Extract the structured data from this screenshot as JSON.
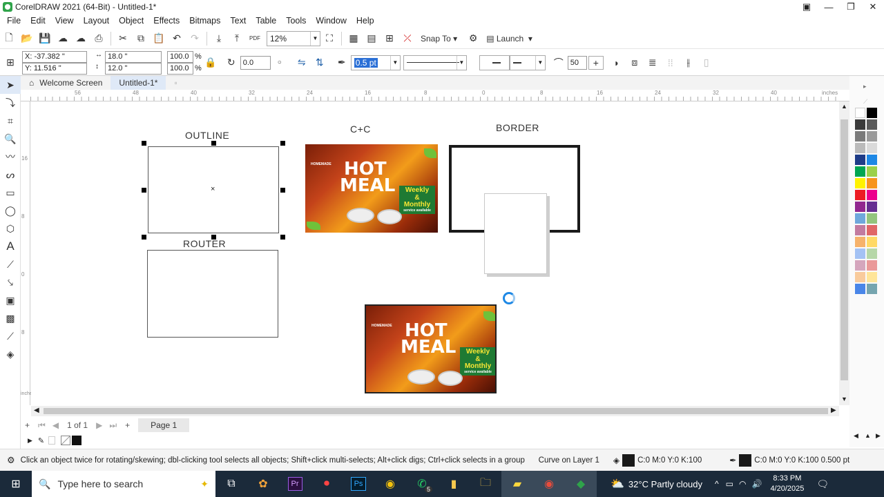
{
  "window": {
    "title": "CorelDRAW 2021 (64-Bit) - Untitled-1*"
  },
  "menu": [
    "File",
    "Edit",
    "View",
    "Layout",
    "Object",
    "Effects",
    "Bitmaps",
    "Text",
    "Table",
    "Tools",
    "Window",
    "Help"
  ],
  "toolbar": {
    "zoom": "12%",
    "snap_label": "Snap To",
    "launch_label": "Launch",
    "pdf_label": "PDF"
  },
  "props": {
    "x": "X: -37.382 \"",
    "y": "Y: 11.516 \"",
    "w": "18.0 \"",
    "h": "12.0 \"",
    "sx": "100.0",
    "sy": "100.0",
    "pct": "%",
    "rotation": "0.0",
    "outline_width": "0.5 pt",
    "radius": "50"
  },
  "tabs": {
    "welcome": "Welcome Screen",
    "doc": "Untitled-1*"
  },
  "ruler": {
    "unit": "inches",
    "h_ticks": [
      "56",
      "48",
      "40",
      "32",
      "24",
      "16",
      "8",
      "0",
      "8",
      "16",
      "24",
      "32",
      "40"
    ],
    "v_ticks": [
      "16",
      "8",
      "0",
      "8"
    ]
  },
  "canvas": {
    "outline_label": "OUTLINE",
    "router_label": "ROUTER",
    "cc_label": "C+C",
    "border_label": "BORDER",
    "poster": {
      "brand": "HOMEMADE",
      "hot": "HOT",
      "meal": "MEAL",
      "weekly": "Weekly",
      "amp": "&",
      "monthly": "Monthly",
      "service": "service available"
    }
  },
  "pagebar": {
    "count": "1 of 1",
    "page": "Page 1"
  },
  "status": {
    "hint": "Click an object twice for rotating/skewing; dbl-clicking tool selects all objects; Shift+click multi-selects; Alt+click digs; Ctrl+click selects in a group",
    "layer": "Curve on Layer 1",
    "fill": "C:0 M:0 Y:0 K:100",
    "outline": "C:0 M:0 Y:0 K:100  0.500 pt"
  },
  "taskbar": {
    "search": "Type here to search",
    "weather": "32°C  Partly cloudy",
    "time": "8:33 PM",
    "date": "4/20/2025",
    "badge": "5"
  },
  "palette_colors": [
    "#ffffff",
    "#000000",
    "#3a3a3a",
    "#5a5a5a",
    "#7a7a7a",
    "#9a9a9a",
    "#bababa",
    "#dadada",
    "#1f3c88",
    "#1e88e5",
    "#00a651",
    "#9bd14a",
    "#fff200",
    "#f7941d",
    "#ed1c24",
    "#ec008c",
    "#92278f",
    "#662d91",
    "#6fa8dc",
    "#93c47d",
    "#c27ba0",
    "#e06666",
    "#f6b26b",
    "#ffd966",
    "#a4c2f4",
    "#b6d7a8",
    "#d5a6bd",
    "#ea9999",
    "#f9cb9c",
    "#ffe599",
    "#4a86e8",
    "#76a5af"
  ],
  "colors": {
    "accent": "#1e88e5",
    "selection": "#000000",
    "taskbar": "#1b2a3a"
  }
}
